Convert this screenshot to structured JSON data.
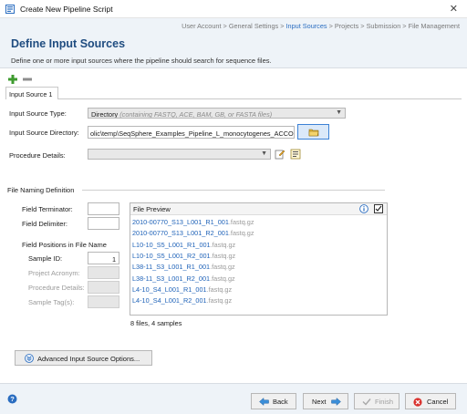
{
  "window": {
    "title": "Create New Pipeline Script",
    "close_glyph": "✕"
  },
  "breadcrumb": {
    "items": [
      "User Account",
      "General Settings",
      "Input Sources",
      "Projects",
      "Submission",
      "File Management"
    ],
    "separator": " > ",
    "active_index": 2
  },
  "header": {
    "title": "Define Input Sources",
    "subtitle": "Define one or more input sources where the pipeline should search for sequence files."
  },
  "toolbar": {
    "add_icon": "add-icon",
    "remove_icon": "remove-icon"
  },
  "tabs": [
    {
      "label": "Input Source 1"
    }
  ],
  "form": {
    "type_label": "Input Source Type:",
    "type_value": "Directory",
    "type_hint": "(containing FASTQ, ACE, BAM, GB, or FASTA files)",
    "dir_label": "Input Source Directory:",
    "dir_value": "olic\\temp\\SeqSphere_Examples_Pipeline_L_monocytogenes_ACCO",
    "proc_label": "Procedure Details:",
    "proc_value": ""
  },
  "naming": {
    "section_title": "File Naming Definition",
    "terminator_label": "Field Terminator:",
    "terminator_value": "",
    "delimiter_label": "Field Delimiter:",
    "delimiter_value": "",
    "positions_title": "Field Positions in File Name",
    "sample_id_label": "Sample ID:",
    "sample_id_value": "1",
    "project_label": "Project Acronym:",
    "procedure_label": "Procedure Details:",
    "tags_label": "Sample Tag(s):"
  },
  "preview": {
    "title": "File Preview",
    "checked": true,
    "files": [
      {
        "name": "2010-00770_S13_L001_R1_001",
        "ext": ".fastq.gz"
      },
      {
        "name": "2010-00770_S13_L001_R2_001",
        "ext": ".fastq.gz"
      },
      {
        "name": "L10-10_S5_L001_R1_001",
        "ext": ".fastq.gz"
      },
      {
        "name": "L10-10_S5_L001_R2_001",
        "ext": ".fastq.gz"
      },
      {
        "name": "L38-11_S3_L001_R1_001",
        "ext": ".fastq.gz"
      },
      {
        "name": "L38-11_S3_L001_R2_001",
        "ext": ".fastq.gz"
      },
      {
        "name": "L4-10_S4_L001_R1_001",
        "ext": ".fastq.gz"
      },
      {
        "name": "L4-10_S4_L001_R2_001",
        "ext": ".fastq.gz"
      }
    ],
    "summary": "8 files, 4 samples"
  },
  "advanced_button": {
    "label": "Advanced Input Source Options..."
  },
  "footer": {
    "back_label": "Back",
    "next_label": "Next",
    "finish_label": "Finish",
    "cancel_label": "Cancel"
  },
  "colors": {
    "accent": "#2a6dc0",
    "title": "#1f4c80",
    "link": "#1e62b8",
    "header_bg": "#eef3f8"
  }
}
